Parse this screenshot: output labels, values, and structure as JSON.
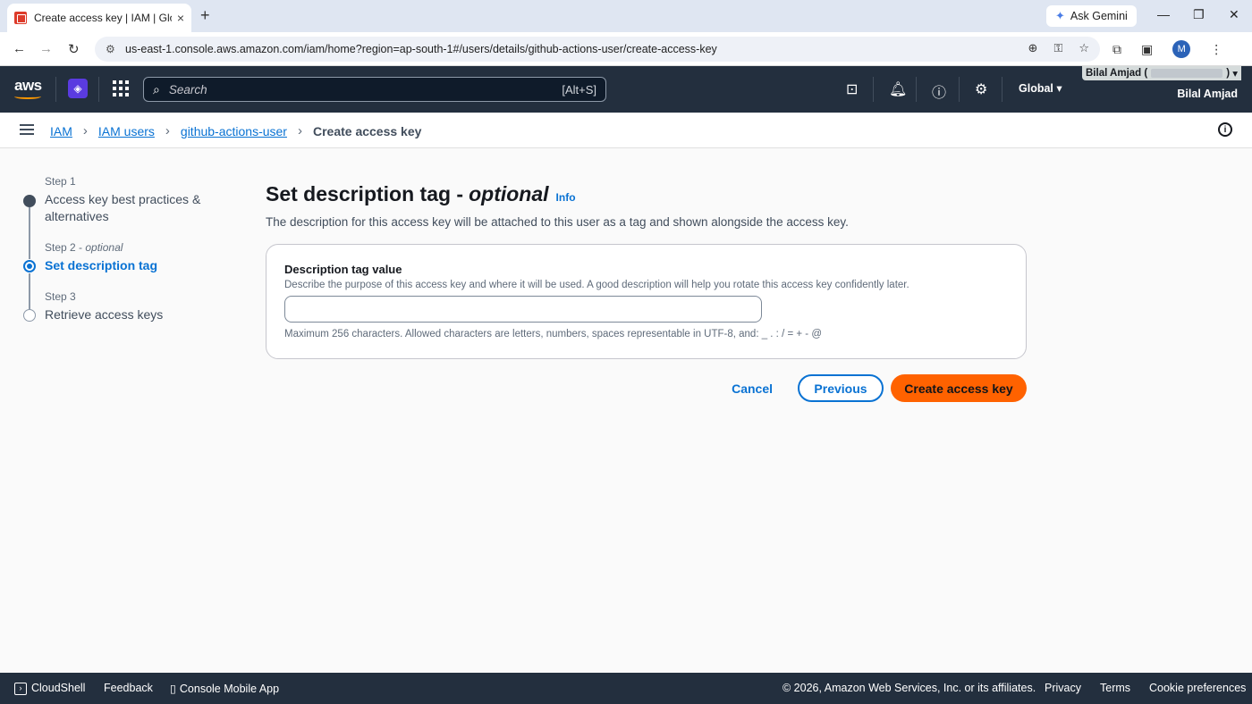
{
  "browser": {
    "tab_title": "Create access key | IAM | Global",
    "tab_close": "×",
    "new_tab": "+",
    "gemini_label": "Ask Gemini",
    "url": "us-east-1.console.aws.amazon.com/iam/home?region=ap-south-1#/users/details/github-actions-user/create-access-key",
    "profile_initial": "M"
  },
  "aws_nav": {
    "logo": "aws",
    "search_placeholder": "Search",
    "search_shortcut": "[Alt+S]",
    "region": "Global",
    "account_top_prefix": "Bilal Amjad (",
    "account_top_suffix": ")",
    "account_name": "Bilal Amjad"
  },
  "breadcrumbs": [
    {
      "label": "IAM"
    },
    {
      "label": "IAM users"
    },
    {
      "label": "github-actions-user"
    },
    {
      "label": "Create access key"
    }
  ],
  "steps": [
    {
      "label": "Step 1",
      "title": "Access key best practices & alternatives",
      "state": "done"
    },
    {
      "label": "Step 2",
      "label_suffix": "optional",
      "title": "Set description tag",
      "state": "active"
    },
    {
      "label": "Step 3",
      "title": "Retrieve access keys",
      "state": "todo"
    }
  ],
  "main": {
    "title": "Set description tag -",
    "title_optional": "optional",
    "info_link": "Info",
    "description": "The description for this access key will be attached to this user as a tag and shown alongside the access key.",
    "field_label": "Description tag value",
    "field_description": "Describe the purpose of this access key and where it will be used. A good description will help you rotate this access key confidently later.",
    "field_value": "",
    "field_constraint": "Maximum 256 characters. Allowed characters are letters, numbers, spaces representable in UTF-8, and: _ . : / = + - @"
  },
  "actions": {
    "cancel": "Cancel",
    "previous": "Previous",
    "create": "Create access key"
  },
  "footer": {
    "cloudshell": "CloudShell",
    "feedback": "Feedback",
    "mobile_app": "Console Mobile App",
    "copyright": "© 2026, Amazon Web Services, Inc. or its affiliates.",
    "privacy": "Privacy",
    "terms": "Terms",
    "cookie": "Cookie preferences"
  },
  "colors": {
    "aws_nav_bg": "#232f3e",
    "link_blue": "#0972d3",
    "primary_orange": "#ff6200"
  }
}
